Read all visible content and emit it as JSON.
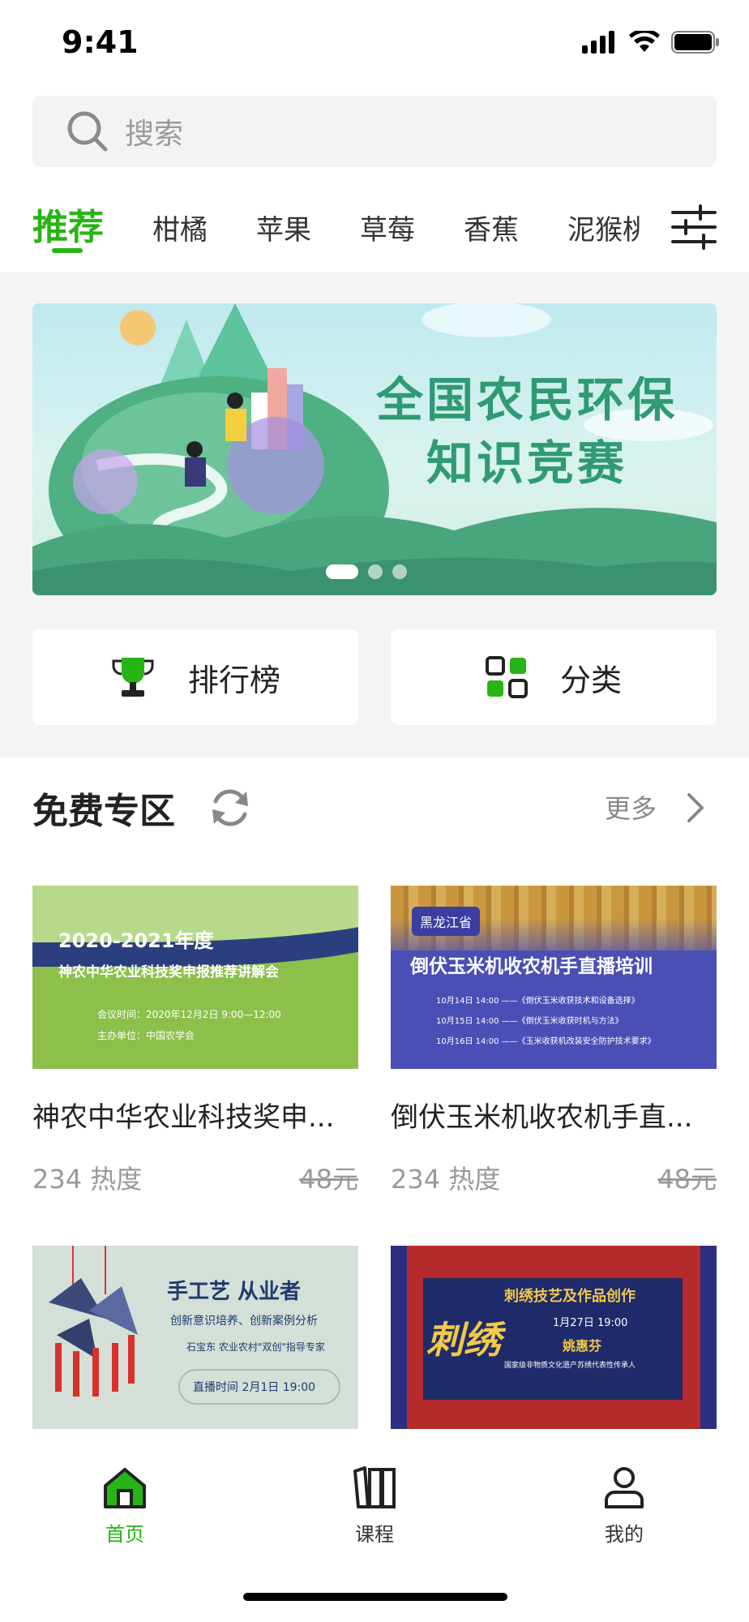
{
  "status_bar": {
    "time": "9:41"
  },
  "search": {
    "placeholder": "搜索"
  },
  "tabs": [
    {
      "label": "推荐",
      "active": true
    },
    {
      "label": "柑橘"
    },
    {
      "label": "苹果"
    },
    {
      "label": "草莓"
    },
    {
      "label": "香蕉"
    },
    {
      "label": "泥猴桃"
    }
  ],
  "banner": {
    "title_line1": "全国农民环保",
    "title_line2": "知识竞赛",
    "active_dot": 0,
    "dot_count": 3
  },
  "quick_actions": {
    "ranking_label": "排行榜",
    "category_label": "分类"
  },
  "free_section": {
    "title": "免费专区",
    "more_label": "更多",
    "cards": [
      {
        "title": "神农中华农业科技奖申...",
        "heat": "234 热度",
        "price": "48元",
        "cover": {
          "line1": "2020-2021年度",
          "line2": "神农中华农业科技奖申报推荐讲解会",
          "line3": "会议时间：2020年12月2日 9:00—12:00",
          "line4": "主办单位：中国农学会"
        }
      },
      {
        "title": "倒伏玉米机收农机手直...",
        "heat": "234 热度",
        "price": "48元",
        "cover": {
          "tag": "黑龙江省",
          "line1": "倒伏玉米机收农机手直播培训",
          "line2": "10月14日 14:00 ——《倒伏玉米收获技术和设备选择》",
          "line3": "10月15日 14:00 ——《倒伏玉米收获时机与方法》",
          "line4": "10月16日 14:00 ——《玉米收获机改装安全防护技术要求》"
        }
      },
      {
        "cover": {
          "line1": "手工艺 从业者",
          "line2": "创新意识培养、创新案例分析",
          "line3": "石宝东 农业农村\"双创\"指导专家",
          "line4": "直播时间  2月1日 19:00"
        }
      },
      {
        "cover": {
          "brush": "刺绣",
          "line1": "刺绣技艺及作品创作",
          "line2": "1月27日 19:00",
          "line3": "姚惠芬",
          "line4": "国家级非物质文化遗产苏绣代表性传承人"
        }
      }
    ]
  },
  "tabbar": {
    "items": [
      {
        "label": "首页",
        "active": true
      },
      {
        "label": "课程"
      },
      {
        "label": "我的"
      }
    ]
  },
  "colors": {
    "accent": "#27b515",
    "banner_text": "#2f9a73",
    "muted": "#999999"
  }
}
